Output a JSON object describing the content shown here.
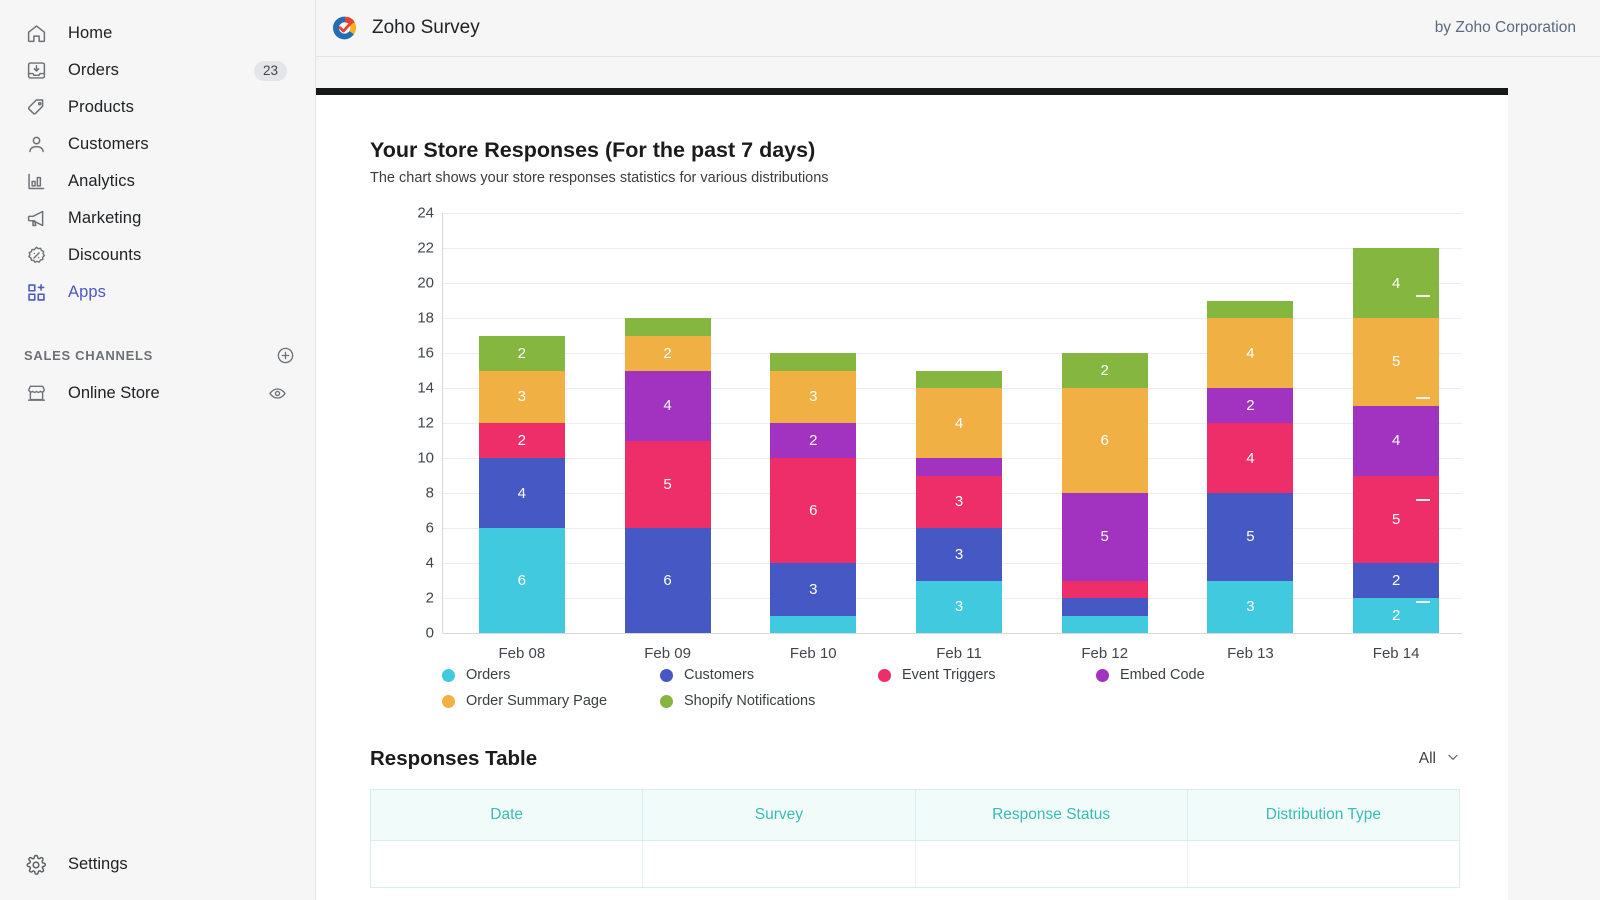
{
  "sidebar": {
    "items": [
      {
        "label": "Home",
        "icon": "home-icon",
        "badge": null,
        "active": false
      },
      {
        "label": "Orders",
        "icon": "orders-icon",
        "badge": "23",
        "active": false
      },
      {
        "label": "Products",
        "icon": "products-tag-icon",
        "badge": null,
        "active": false
      },
      {
        "label": "Customers",
        "icon": "customers-person-icon",
        "badge": null,
        "active": false
      },
      {
        "label": "Analytics",
        "icon": "analytics-bars-icon",
        "badge": null,
        "active": false
      },
      {
        "label": "Marketing",
        "icon": "marketing-megaphone-icon",
        "badge": null,
        "active": false
      },
      {
        "label": "Discounts",
        "icon": "discounts-percent-icon",
        "badge": null,
        "active": false
      },
      {
        "label": "Apps",
        "icon": "apps-grid-plus-icon",
        "badge": null,
        "active": true
      }
    ],
    "sales_channels": {
      "title": "SALES CHANNELS",
      "add_icon": "plus-circle-icon",
      "items": [
        {
          "label": "Online Store",
          "icon": "store-icon",
          "action_icon": "eye-icon"
        }
      ]
    },
    "settings": {
      "label": "Settings",
      "icon": "gear-icon"
    }
  },
  "topbar": {
    "logo_icon": "zoho-survey-logo-icon",
    "app_title": "Zoho Survey",
    "attribution": "by Zoho Corporation"
  },
  "chart_data": {
    "type": "bar",
    "stacked": true,
    "title": "Your Store Responses (For the past 7 days)",
    "subtitle": "The chart shows your store responses statistics for various distributions",
    "categories": [
      "Feb 08",
      "Feb 09",
      "Feb 10",
      "Feb 11",
      "Feb 12",
      "Feb 13",
      "Feb 14"
    ],
    "xlabel": "",
    "ylabel": "",
    "ylim": [
      0,
      24
    ],
    "ytick_step": 2,
    "yticks": [
      0,
      2,
      4,
      6,
      8,
      10,
      12,
      14,
      16,
      18,
      20,
      22,
      24
    ],
    "grid": true,
    "legend_position": "bottom",
    "series": [
      {
        "name": "Orders",
        "color": "#40c9df",
        "values": [
          6,
          0,
          1,
          3,
          1,
          3,
          2
        ]
      },
      {
        "name": "Customers",
        "color": "#4558c4",
        "values": [
          4,
          6,
          3,
          3,
          1,
          5,
          2
        ]
      },
      {
        "name": "Event Triggers",
        "color": "#ed2e68",
        "values": [
          2,
          5,
          6,
          3,
          1,
          4,
          5
        ]
      },
      {
        "name": "Embed Code",
        "color": "#a232c0",
        "values": [
          0,
          4,
          2,
          1,
          5,
          2,
          4
        ]
      },
      {
        "name": "Order Summary Page",
        "color": "#f0b044",
        "values": [
          3,
          2,
          3,
          4,
          6,
          4,
          5
        ]
      },
      {
        "name": "Shopify Notifications",
        "color": "#84b640",
        "values": [
          2,
          1,
          1,
          1,
          2,
          1,
          4
        ]
      }
    ],
    "totals": [
      17,
      18,
      16,
      15,
      16,
      19,
      22
    ]
  },
  "responses_table": {
    "title": "Responses Table",
    "filter_value": "All",
    "filter_icon": "chevron-down-icon",
    "columns": [
      "Date",
      "Survey",
      "Response Status",
      "Distribution Type"
    ],
    "rows": [
      {
        "date": "",
        "survey": "",
        "status": "",
        "type": ""
      }
    ]
  }
}
